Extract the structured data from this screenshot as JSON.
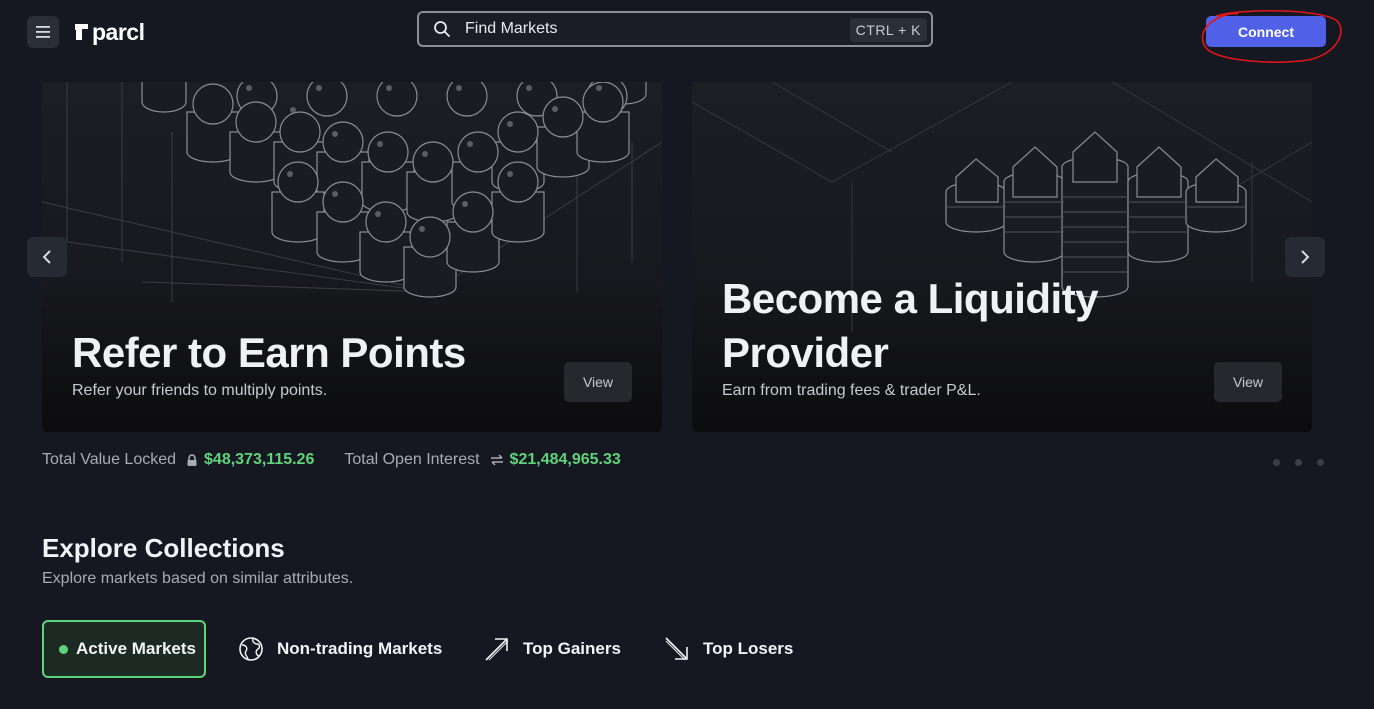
{
  "header": {
    "logo_text": "parcl",
    "search": {
      "placeholder": "Find Markets",
      "shortcut": "CTRL + K"
    },
    "connect_label": "Connect"
  },
  "carousel": {
    "cards": [
      {
        "title": "Refer to Earn Points",
        "subtitle": "Refer your friends to multiply points.",
        "button": "View"
      },
      {
        "title_line1": "Become a Liquidity",
        "title_line2": "Provider",
        "subtitle": "Earn from trading fees & trader P&L.",
        "button": "View"
      }
    ],
    "page_count": 3
  },
  "stats": {
    "tvl_label": "Total Value Locked",
    "tvl_value": "$48,373,115.26",
    "oi_label": "Total Open Interest",
    "oi_value": "$21,484,965.33"
  },
  "explore": {
    "title": "Explore Collections",
    "subtitle": "Explore markets based on similar attributes.",
    "tabs": [
      {
        "label": "Active Markets",
        "icon": "green-dot-icon",
        "active": true
      },
      {
        "label": "Non-trading Markets",
        "icon": "globe-icon",
        "active": false
      },
      {
        "label": "Top Gainers",
        "icon": "arrow-up-right-icon",
        "active": false
      },
      {
        "label": "Top Losers",
        "icon": "arrow-down-right-icon",
        "active": false
      }
    ]
  },
  "colors": {
    "background": "#151821",
    "accent": "#5061e8",
    "positive": "#5fd37a",
    "annotation": "#e0161b"
  }
}
